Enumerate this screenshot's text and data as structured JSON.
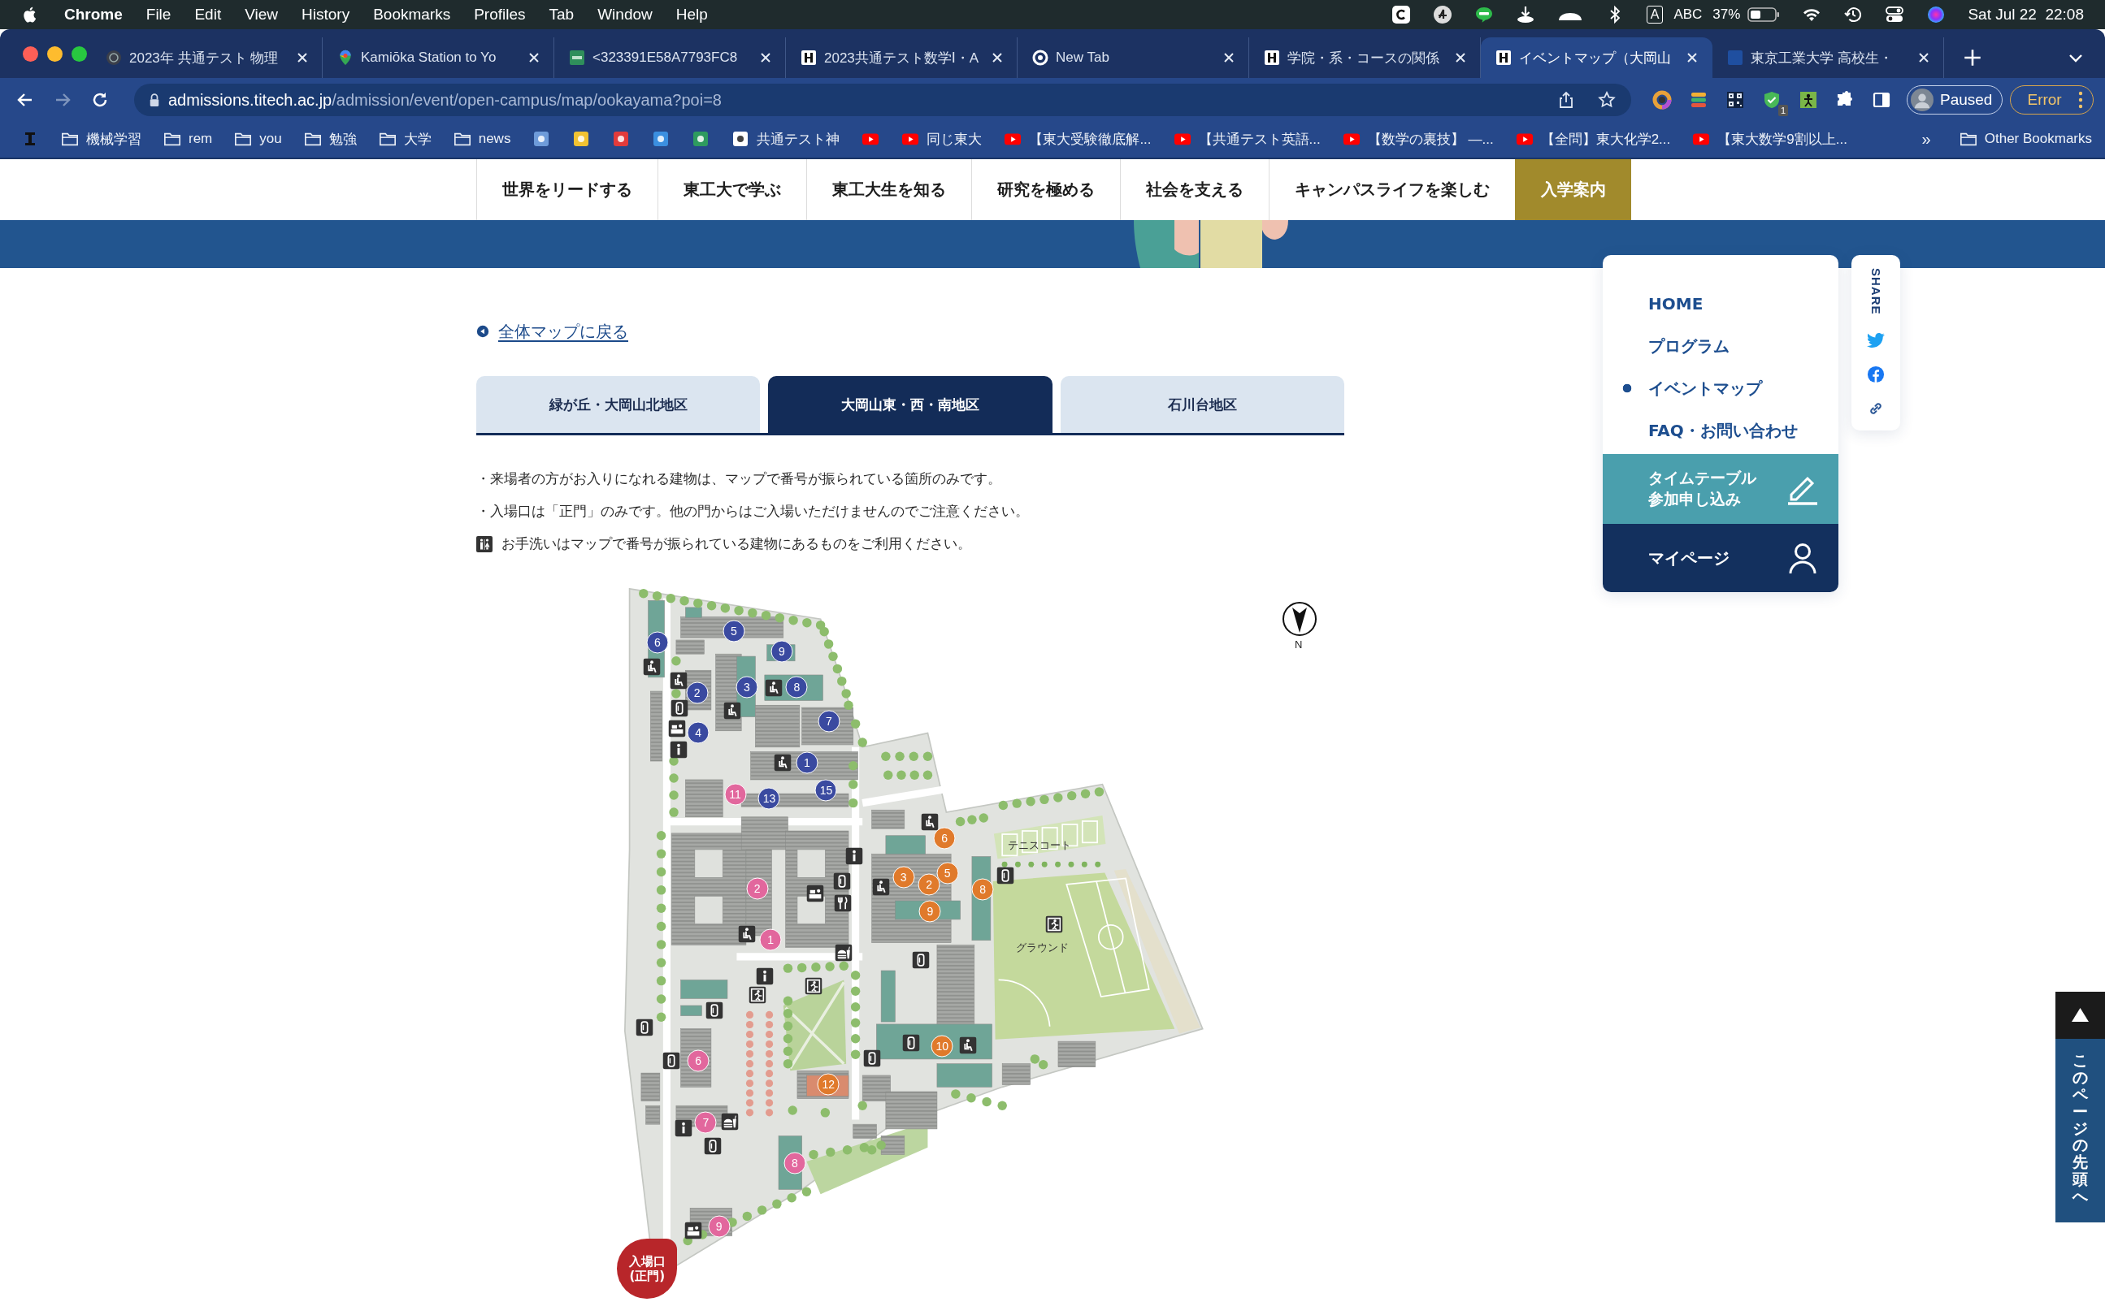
{
  "menu_bar": {
    "app": "Chrome",
    "items": [
      "File",
      "Edit",
      "View",
      "History",
      "Bookmarks",
      "Profiles",
      "Tab",
      "Window",
      "Help"
    ],
    "input_source": "A",
    "input_name": "ABC",
    "battery": "37%",
    "clock": "Sat Jul 22  22:08"
  },
  "browser": {
    "tabs": [
      {
        "title": "2023年 共通テスト 物理",
        "selected": false
      },
      {
        "title": "Kamiōka Station to Yo",
        "selected": false
      },
      {
        "title": "<323391E58A7793FC8",
        "selected": false
      },
      {
        "title": "2023共通テスト数学Ⅰ・A",
        "selected": false
      },
      {
        "title": "New Tab",
        "selected": false
      },
      {
        "title": "学院・系・コースの関係",
        "selected": false
      },
      {
        "title": "イベントマップ（大岡山",
        "selected": true
      },
      {
        "title": "東京工業大学 高校生・",
        "selected": false
      }
    ],
    "url_host": "admissions.titech.ac.jp",
    "url_path": "/admission/event/open-campus/map/ookayama?poi=8",
    "extension_badge": "1",
    "profile": "Paused",
    "error": "Error",
    "bookmarks": [
      {
        "kind": "site"
      },
      {
        "kind": "folder",
        "label": "機械学習"
      },
      {
        "kind": "folder",
        "label": "rem"
      },
      {
        "kind": "folder",
        "label": "you"
      },
      {
        "kind": "folder",
        "label": "勉強"
      },
      {
        "kind": "folder",
        "label": "大学"
      },
      {
        "kind": "folder",
        "label": "news"
      },
      {
        "kind": "site"
      },
      {
        "kind": "site"
      },
      {
        "kind": "site"
      },
      {
        "kind": "site"
      },
      {
        "kind": "site"
      },
      {
        "kind": "site",
        "label": "共通テスト神"
      },
      {
        "kind": "video"
      },
      {
        "kind": "video",
        "label": "同じ東大"
      },
      {
        "kind": "video",
        "label": "【東大受験徹底解..."
      },
      {
        "kind": "video",
        "label": "【共通テスト英語..."
      },
      {
        "kind": "video",
        "label": "【数学の裏技】 —..."
      },
      {
        "kind": "video",
        "label": "【全問】東大化学2..."
      },
      {
        "kind": "video",
        "label": "【東大数学9割以上..."
      }
    ],
    "bookmarks_overflow": "»",
    "other_bookmarks": "Other Bookmarks"
  },
  "site_nav": [
    {
      "label": "世界をリードする",
      "selected": false
    },
    {
      "label": "東工大で学ぶ",
      "selected": false
    },
    {
      "label": "東工大生を知る",
      "selected": false
    },
    {
      "label": "研究を極める",
      "selected": false
    },
    {
      "label": "社会を支える",
      "selected": false
    },
    {
      "label": "キャンパスライフを楽しむ",
      "selected": false
    },
    {
      "label": "入学案内",
      "selected": true
    }
  ],
  "back_link": "全体マップに戻る",
  "area_tabs": [
    {
      "label": "緑が丘・大岡山北地区",
      "selected": false
    },
    {
      "label": "大岡山東・西・南地区",
      "selected": true
    },
    {
      "label": "石川台地区",
      "selected": false
    }
  ],
  "notes": [
    {
      "kind": "text",
      "text": "・来場者の方がお入りになれる建物は、マップで番号が振られている箇所のみです。"
    },
    {
      "kind": "text",
      "text": "・入場口は「正門」のみです。他の門からはご入場いただけませんのでご注意ください。"
    },
    {
      "kind": "restroom",
      "text": "お手洗いはマップで番号が振られている建物にあるものをご利用ください。"
    }
  ],
  "map": {
    "markers": [
      {
        "label": "6",
        "color": "#3a4aa0"
      },
      {
        "label": "5",
        "color": "#3a4aa0"
      },
      {
        "label": "9",
        "color": "#3a4aa0"
      },
      {
        "label": "2",
        "color": "#3a4aa0"
      },
      {
        "label": "3",
        "color": "#3a4aa0"
      },
      {
        "label": "8",
        "color": "#3a4aa0"
      },
      {
        "label": "4",
        "color": "#3a4aa0"
      },
      {
        "label": "7",
        "color": "#3a4aa0"
      },
      {
        "label": "1",
        "color": "#3a4aa0"
      },
      {
        "label": "15",
        "color": "#3a4aa0"
      },
      {
        "label": "13",
        "color": "#3a4aa0"
      },
      {
        "label": "11",
        "color": "#e2679d"
      },
      {
        "label": "2",
        "color": "#e2679d"
      },
      {
        "label": "1",
        "color": "#e2679d"
      },
      {
        "label": "6",
        "color": "#e2679d"
      },
      {
        "label": "7",
        "color": "#e2679d"
      },
      {
        "label": "8",
        "color": "#e2679d"
      },
      {
        "label": "9",
        "color": "#e2679d"
      },
      {
        "label": "6",
        "color": "#e07a2b"
      },
      {
        "label": "3",
        "color": "#e07a2b"
      },
      {
        "label": "5",
        "color": "#e07a2b"
      },
      {
        "label": "2",
        "color": "#e07a2b"
      },
      {
        "label": "8",
        "color": "#e07a2b"
      },
      {
        "label": "9",
        "color": "#e07a2b"
      },
      {
        "label": "10",
        "color": "#e07a2b"
      },
      {
        "label": "12",
        "color": "#e07a2b"
      }
    ],
    "tennis_label": "テニスコート",
    "ground_label": "グラウンド",
    "entrance": [
      "入場口",
      "(正門)"
    ],
    "compass": "N"
  },
  "side_menu": {
    "items": [
      {
        "label": "HOME",
        "selected": false
      },
      {
        "label": "プログラム",
        "selected": false
      },
      {
        "label": "イベントマップ",
        "selected": true
      },
      {
        "label": "FAQ・お問い合わせ",
        "selected": false
      }
    ],
    "signup": [
      "タイムテーブル",
      "参加申し込み"
    ],
    "mypage": "マイページ"
  },
  "share": "SHARE",
  "page_top": "このページの先頭へ"
}
